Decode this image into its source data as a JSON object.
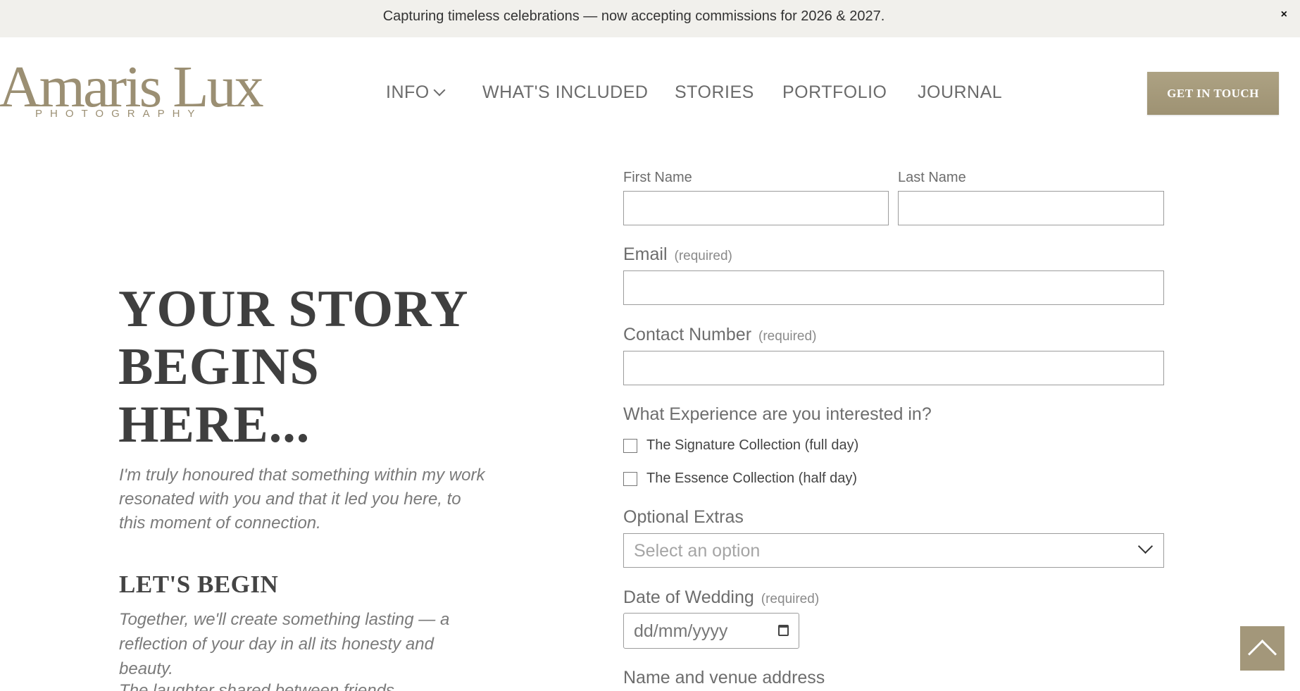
{
  "announcement": {
    "text": "Capturing timeless celebrations — now accepting commissions for 2026 & 2027.",
    "close_symbol": "×"
  },
  "brand": {
    "name": "Amaris Lux",
    "tagline": "PHOTOGRAPHY",
    "color": "#9b8f73"
  },
  "nav": {
    "items": [
      {
        "label": "INFO",
        "has_dropdown": true
      },
      {
        "label": "WHAT'S INCLUDED"
      },
      {
        "label": "STORIES"
      },
      {
        "label": "PORTFOLIO"
      },
      {
        "label": "JOURNAL"
      }
    ],
    "cta_label": "GET IN TOUCH"
  },
  "hero": {
    "title": "YOUR STORY BEGINS HERE...",
    "intro": "I'm truly honoured that something within my work resonated with you and that it led you here, to this moment of connection.",
    "section_heading": "LET'S BEGIN",
    "section_text": "Together, we'll create something lasting — a reflection of your day in all its honesty and beauty.",
    "cutoff_text": "The laughter shared between friends"
  },
  "form": {
    "first_name": {
      "label": "First Name",
      "value": ""
    },
    "last_name": {
      "label": "Last Name",
      "value": ""
    },
    "email": {
      "label": "Email",
      "required_text": "(required)",
      "value": ""
    },
    "contact_number": {
      "label": "Contact Number",
      "required_text": "(required)",
      "value": ""
    },
    "experience": {
      "label": "What Experience are you interested in?",
      "options": [
        {
          "label": "The Signature Collection (full day)",
          "checked": false
        },
        {
          "label": "The Essence Collection (half day)",
          "checked": false
        }
      ]
    },
    "optional_extras": {
      "label": "Optional Extras",
      "placeholder": "Select an option"
    },
    "wedding_date": {
      "label": "Date of Wedding",
      "required_text": "(required)",
      "placeholder": "dd/mm/yyyy"
    },
    "venue": {
      "label": "Name and venue address"
    }
  },
  "colors": {
    "accent": "#a3977a",
    "announcement_bg": "#f1f0ec"
  },
  "icons": {
    "close": "close-icon",
    "info_dropdown": "chevron-down-icon",
    "select": "chevron-down-icon",
    "calendar": "calendar-icon",
    "back_to_top": "chevron-up-icon"
  }
}
